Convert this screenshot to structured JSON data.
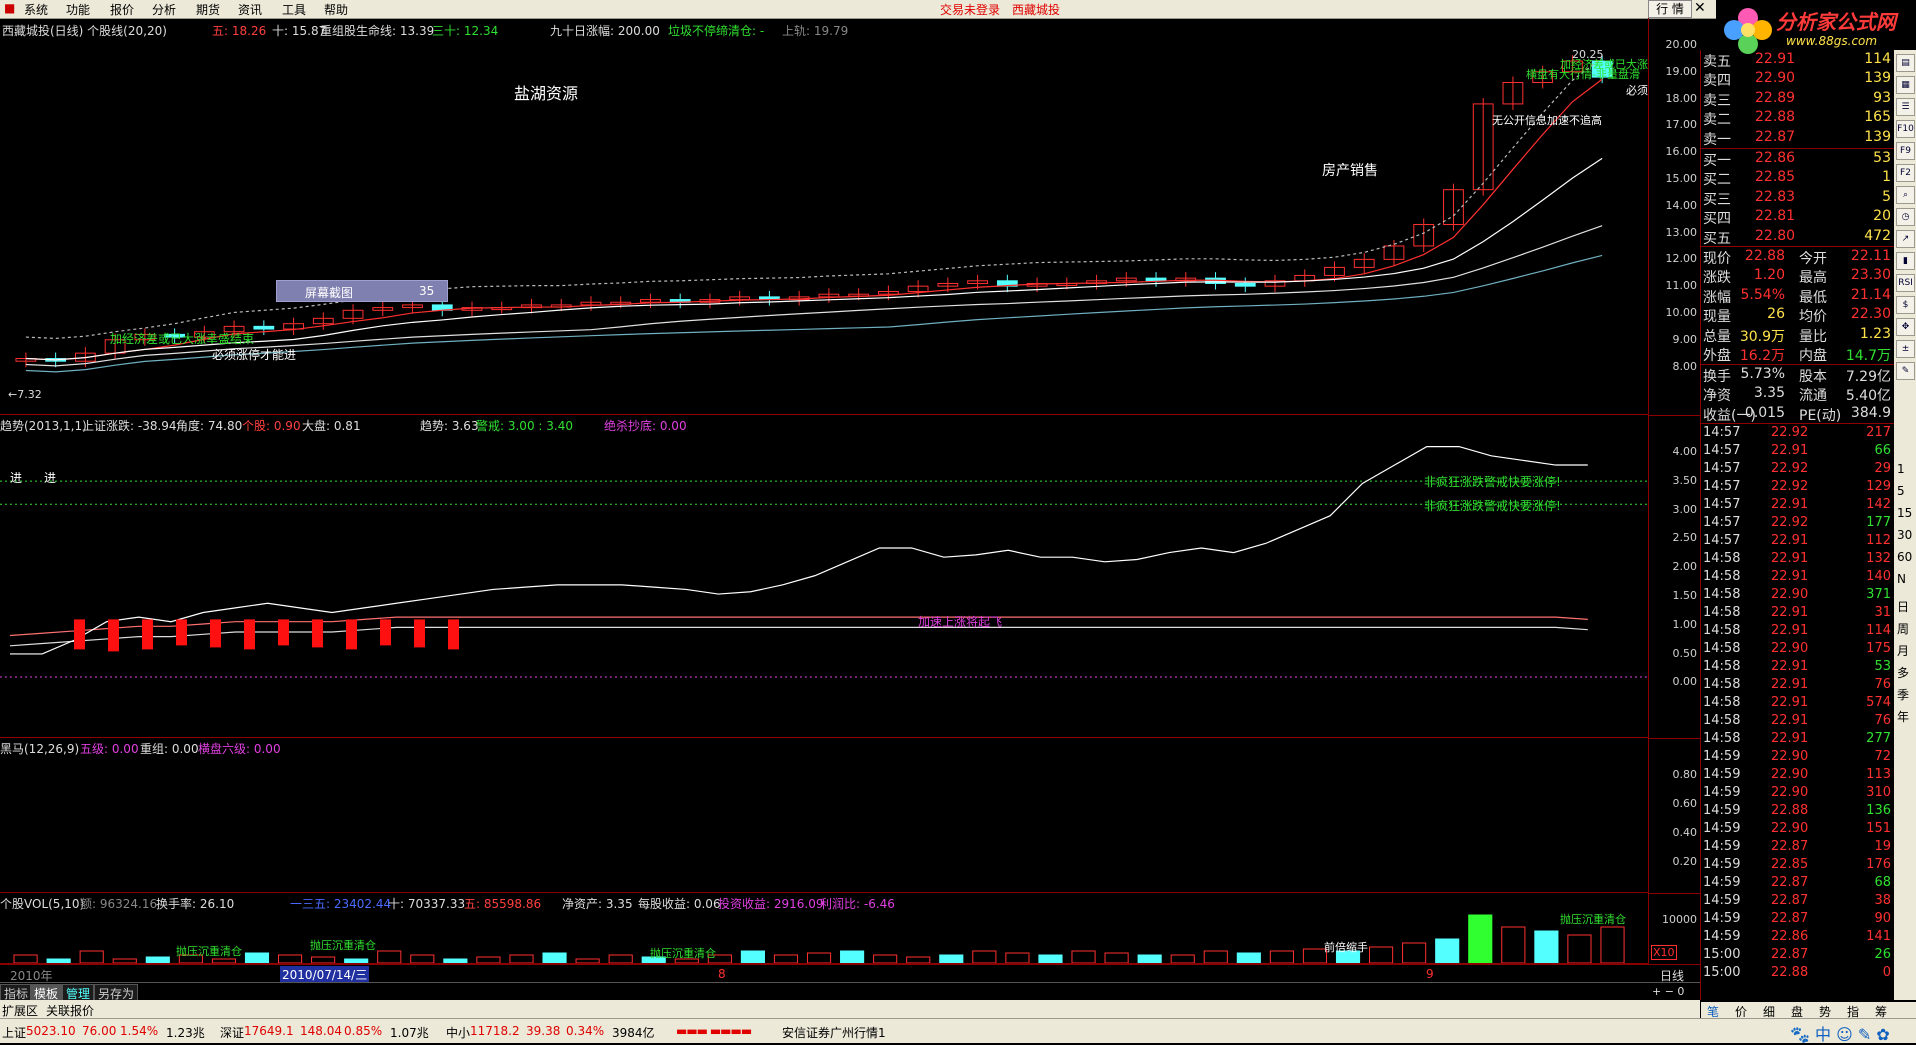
{
  "menu": {
    "items": [
      "系统",
      "功能",
      "报价",
      "分析",
      "期货",
      "资讯",
      "工具",
      "帮助"
    ],
    "trade_status": "交易未登录",
    "stock_name": "西藏城投",
    "quote_button": "行 情"
  },
  "logo": {
    "text": "分析家公式网",
    "url": "www.88gs.com"
  },
  "main_chart": {
    "header": {
      "title": "西藏城投(日线) 个股线(20,20)",
      "ma5": "五: 18.26",
      "ma10": "十: 15.87",
      "reorg": "重组股生命线: 13.39",
      "ma30": "三十: 12.34",
      "rise90": "九十日涨幅: 200.00",
      "junk": "垃圾不停缔清仓: -",
      "upper": "上轨: 19.79"
    },
    "y_ticks": [
      "20.00",
      "19.00",
      "18.00",
      "17.00",
      "16.00",
      "15.00",
      "14.00",
      "13.00",
      "12.00",
      "11.00",
      "10.00",
      "9.00",
      "8.00"
    ],
    "annotations": {
      "concept1": "盐湖资源",
      "concept2": "房产销售",
      "screenshot_label": "屏幕截图",
      "screenshot_num": "35",
      "hi_label": "20.25",
      "lo_label": "←7.32",
      "note1": "加经济差或已大涨幸盛结束",
      "note2": "必须涨停才能进",
      "note3": "无公开信息加速不追高",
      "note4": "横盘有大行情-非量盘滑",
      "note5": "加经济差或已大涨",
      "note6": "必须"
    },
    "colors": {
      "up": "#ff3030",
      "down": "#54ffff"
    }
  },
  "trend_chart": {
    "header": {
      "title": "趋势(2013,1,1)",
      "sh_rise": "上证涨跌: -38.94",
      "angle": "角度: 74.80",
      "stock": "个股: 0.90",
      "market": "大盘: 0.81",
      "trend": "趋势: 3.63",
      "warn": "警戒: 3.00 : 3.40",
      "bottom": "绝杀抄底: 0.00"
    },
    "y_ticks": [
      "4.00",
      "3.50",
      "3.00",
      "2.50",
      "2.00",
      "1.50",
      "1.00",
      "0.50",
      "0.00"
    ],
    "annotations": {
      "enter": "进",
      "enter2": "进",
      "crazy": "非疯狂涨跌警戒快要涨停!",
      "speed": "加速上涨将起飞"
    }
  },
  "horse_chart": {
    "header": {
      "title": "黑马(12,26,9)",
      "five": "五级: 0.00",
      "reorg": "重组: 0.00",
      "six": "横盘六级: 0.00"
    },
    "y_ticks": [
      "0.80",
      "0.60",
      "0.40",
      "0.20"
    ]
  },
  "vol_chart": {
    "header": {
      "title": "个股VOL(5,10)",
      "amount": "额: 96324.16",
      "turnover": "换手率: 26.10",
      "v35": "一三五: 23402.44",
      "v10": "十: 70337.33",
      "v5": "五: 85598.86",
      "nav": "净资产: 3.35",
      "eps": "每股收益: 0.06",
      "invest": "投资收益: 2916.09",
      "profit": "利润比: -6.46"
    },
    "y_ticks": [
      "10000"
    ],
    "x10": "X10",
    "annotations": {
      "drop": "抛压沉重清仓",
      "double": "前倍缩手"
    }
  },
  "time_axis": {
    "year": "2010年",
    "date": "2010/07/14/三",
    "m8": "8",
    "m9": "9",
    "period": "日线"
  },
  "tabs": [
    "指标",
    "模板",
    "管理",
    "另存为"
  ],
  "tabs2": [
    "扩展区",
    "关联报价"
  ],
  "quote": {
    "asks": [
      {
        "label": "卖五",
        "price": "22.91",
        "vol": "114"
      },
      {
        "label": "卖四",
        "price": "22.90",
        "vol": "139"
      },
      {
        "label": "卖三",
        "price": "22.89",
        "vol": "93"
      },
      {
        "label": "卖二",
        "price": "22.88",
        "vol": "165"
      },
      {
        "label": "卖一",
        "price": "22.87",
        "vol": "139"
      }
    ],
    "bids": [
      {
        "label": "买一",
        "price": "22.86",
        "vol": "53"
      },
      {
        "label": "买二",
        "price": "22.85",
        "vol": "1"
      },
      {
        "label": "买三",
        "price": "22.83",
        "vol": "5"
      },
      {
        "label": "买四",
        "price": "22.81",
        "vol": "20"
      },
      {
        "label": "买五",
        "price": "22.80",
        "vol": "472"
      }
    ],
    "stats": [
      {
        "l1": "现价",
        "v1": "22.88",
        "l2": "今开",
        "v2": "22.11"
      },
      {
        "l1": "涨跌",
        "v1": "1.20",
        "l2": "最高",
        "v2": "23.30"
      },
      {
        "l1": "涨幅",
        "v1": "5.54%",
        "l2": "最低",
        "v2": "21.14"
      },
      {
        "l1": "现量",
        "v1": "26",
        "l2": "均价",
        "v2": "22.30"
      },
      {
        "l1": "总量",
        "v1": "30.9万",
        "l2": "量比",
        "v2": "1.23"
      },
      {
        "l1": "外盘",
        "v1": "16.2万",
        "l2": "内盘",
        "v2": "14.7万"
      }
    ],
    "stats2": [
      {
        "l1": "换手",
        "v1": "5.73%",
        "l2": "股本",
        "v2": "7.29亿"
      },
      {
        "l1": "净资",
        "v1": "3.35",
        "l2": "流通",
        "v2": "5.40亿"
      },
      {
        "l1": "收益(一)",
        "v1": "0.015",
        "l2": "PE(动)",
        "v2": "384.9"
      }
    ],
    "ticks": [
      [
        "14:57",
        "22.92",
        "217"
      ],
      [
        "14:57",
        "22.91",
        "66"
      ],
      [
        "14:57",
        "22.92",
        "29"
      ],
      [
        "14:57",
        "22.92",
        "129"
      ],
      [
        "14:57",
        "22.91",
        "142"
      ],
      [
        "14:57",
        "22.92",
        "177"
      ],
      [
        "14:57",
        "22.91",
        "112"
      ],
      [
        "14:58",
        "22.91",
        "132"
      ],
      [
        "14:58",
        "22.91",
        "140"
      ],
      [
        "14:58",
        "22.90",
        "371"
      ],
      [
        "14:58",
        "22.91",
        "31"
      ],
      [
        "14:58",
        "22.91",
        "114"
      ],
      [
        "14:58",
        "22.90",
        "175"
      ],
      [
        "14:58",
        "22.91",
        "53"
      ],
      [
        "14:58",
        "22.91",
        "76"
      ],
      [
        "14:58",
        "22.91",
        "574"
      ],
      [
        "14:58",
        "22.91",
        "76"
      ],
      [
        "14:58",
        "22.91",
        "277"
      ],
      [
        "14:59",
        "22.90",
        "72"
      ],
      [
        "14:59",
        "22.90",
        "113"
      ],
      [
        "14:59",
        "22.90",
        "310"
      ],
      [
        "14:59",
        "22.88",
        "136"
      ],
      [
        "14:59",
        "22.90",
        "151"
      ],
      [
        "14:59",
        "22.87",
        "19"
      ],
      [
        "14:59",
        "22.85",
        "176"
      ],
      [
        "14:59",
        "22.87",
        "68"
      ],
      [
        "14:59",
        "22.87",
        "38"
      ],
      [
        "14:59",
        "22.87",
        "90"
      ],
      [
        "14:59",
        "22.86",
        "141"
      ],
      [
        "15:00",
        "22.87",
        "26"
      ],
      [
        "15:00",
        "22.88",
        "0"
      ]
    ],
    "bottom_tabs": [
      "笔",
      "价",
      "细",
      "盘",
      "势",
      "指",
      "筹"
    ]
  },
  "right_tools": [
    "日",
    "周",
    "月",
    "多",
    "季",
    "年"
  ],
  "status": {
    "sh_label": "上证",
    "sh_val": "5023.10",
    "sh_chg": "76.00",
    "sh_pct": "1.54%",
    "sh_amt": "1.23兆",
    "sz_label": "深证",
    "sz_val": "17649.1",
    "sz_chg": "148.04",
    "sz_pct": "0.85%",
    "sz_amt": "1.07兆",
    "zx_label": "中小",
    "zx_val": "11718.2",
    "zx_chg": "39.38",
    "zx_pct": "0.34%",
    "zx_amt": "3984亿",
    "server": "安信证券广州行情1"
  }
}
